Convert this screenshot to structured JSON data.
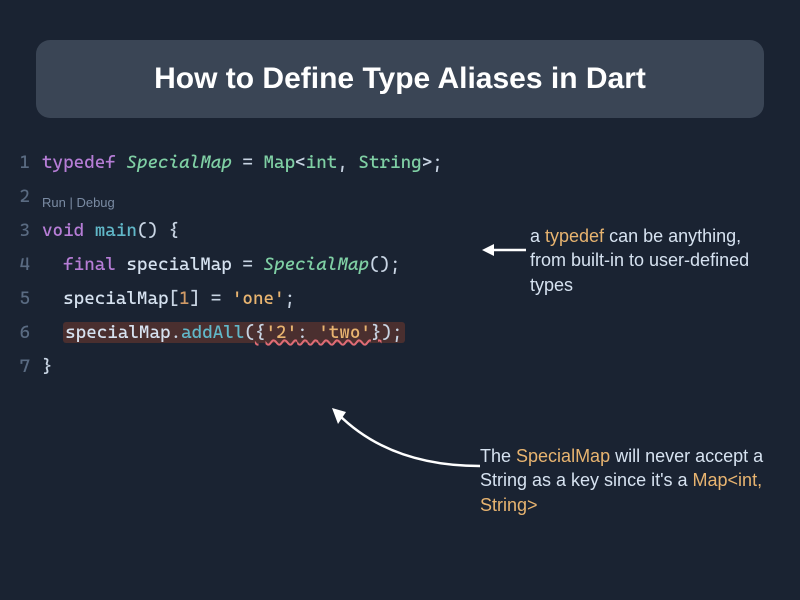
{
  "title": "How to Define Type Aliases in Dart",
  "gutter": [
    "1",
    "2",
    "3",
    "4",
    "5",
    "6",
    "7"
  ],
  "codelens": "Run | Debug",
  "code": {
    "l1": {
      "typedef": "typedef",
      "sp1": " ",
      "name": "SpecialMap",
      "sp2": " ",
      "eq": "=",
      "sp3": " ",
      "map": "Map",
      "lt": "<",
      "int": "int",
      "comma": ",",
      "sp4": " ",
      "string": "String",
      "gt": ">",
      "semi": ";"
    },
    "l3": {
      "void": "void",
      "sp1": " ",
      "main": "main",
      "parens": "()",
      "sp2": " ",
      "brace": "{"
    },
    "l4": {
      "indent": "  ",
      "final": "final",
      "sp1": " ",
      "var": "specialMap",
      "sp2": " ",
      "eq": "=",
      "sp3": " ",
      "ctor": "SpecialMap",
      "call": "()",
      "semi": ";"
    },
    "l5": {
      "indent": "  ",
      "var": "specialMap",
      "lb": "[",
      "idx": "1",
      "rb": "]",
      "sp1": " ",
      "eq": "=",
      "sp2": " ",
      "str": "'one'",
      "semi": ";"
    },
    "l6": {
      "indent": "  ",
      "var": "specialMap",
      "dot": ".",
      "method": "addAll",
      "lp": "(",
      "lbr": "{",
      "key": "'2'",
      "colon": ":",
      "sp1": " ",
      "val": "'two'",
      "rbr": "}",
      "rp": ")",
      "semi": ";"
    },
    "l7": {
      "brace": "}"
    }
  },
  "ann1": {
    "pre": "a ",
    "kw": "typedef",
    "post": " can be anything, from built-in to user-defined types"
  },
  "ann2": {
    "pre": "The ",
    "kw": "SpecialMap",
    "mid": " will never accept a String as a key since it's a ",
    "type": "Map<int, String>"
  }
}
